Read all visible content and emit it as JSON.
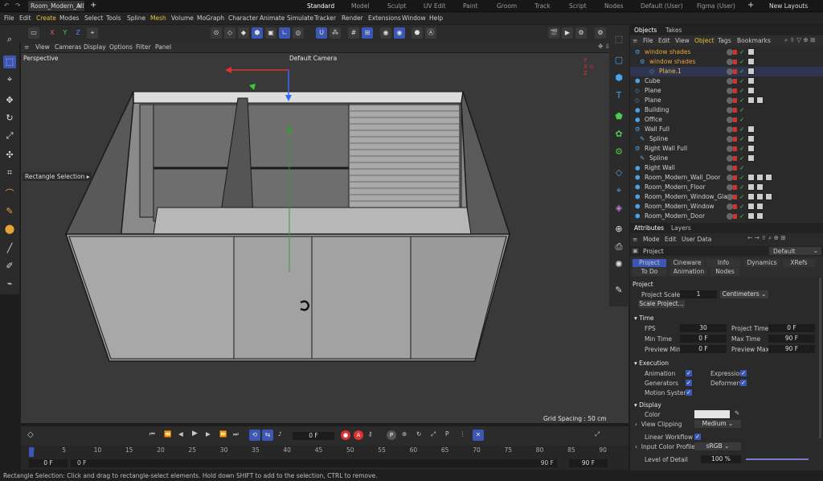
{
  "tabs": {
    "doc_title": "Room_Modern_All...",
    "layouts": [
      "Standard",
      "Model",
      "Sculpt",
      "UV Edit",
      "Paint",
      "Groom",
      "Track",
      "Script",
      "Nodes",
      "Default (User)",
      "Figma (User)"
    ],
    "new_layouts": "New Layouts"
  },
  "menu": [
    "File",
    "Edit",
    "Create",
    "Modes",
    "Select",
    "Tools",
    "Spline",
    "Mesh",
    "Volume",
    "MoGraph",
    "Character",
    "Animate",
    "Simulate",
    "Tracker",
    "Render",
    "Extensions",
    "Window",
    "Help"
  ],
  "axes_buttons": [
    "X",
    "Y",
    "Z"
  ],
  "viewport": {
    "menu": [
      "View",
      "Cameras",
      "Display",
      "Options",
      "Filter",
      "Panel"
    ],
    "label": "Perspective",
    "camera": "Default Camera",
    "tooltip": "Rectangle Selection",
    "grid_spacing": "Grid Spacing : 50 cm"
  },
  "objects": {
    "tabs": [
      "Objects",
      "Takes"
    ],
    "menu": [
      "File",
      "Edit",
      "View",
      "Object",
      "Tags",
      "Bookmarks"
    ],
    "rows": [
      {
        "name": "window shades",
        "color": "#e8a437"
      },
      {
        "name": "window shades",
        "color": "#e8a437"
      },
      {
        "name": "Plane.1",
        "color": "#e8c237"
      },
      {
        "name": "Cube",
        "color": "#d0d0d0"
      },
      {
        "name": "Plane",
        "color": "#d0d0d0"
      },
      {
        "name": "Plane",
        "color": "#d0d0d0"
      },
      {
        "name": "Building",
        "color": "#d0d0d0"
      },
      {
        "name": "Office",
        "color": "#d0d0d0"
      },
      {
        "name": "Wall Full",
        "color": "#d0d0d0"
      },
      {
        "name": "Spline",
        "color": "#d0d0d0"
      },
      {
        "name": "Right Wall Full",
        "color": "#d0d0d0"
      },
      {
        "name": "Spline",
        "color": "#d0d0d0"
      },
      {
        "name": "Right Wall",
        "color": "#d0d0d0"
      },
      {
        "name": "Room_Modern_Wall_Door",
        "color": "#d0d0d0"
      },
      {
        "name": "Room_Modern_Floor",
        "color": "#d0d0d0"
      },
      {
        "name": "Room_Modern_Window_Glass",
        "color": "#d0d0d0"
      },
      {
        "name": "Room_Modern_Window",
        "color": "#d0d0d0"
      },
      {
        "name": "Room_Modern_Door",
        "color": "#d0d0d0"
      }
    ]
  },
  "attributes": {
    "tabs": [
      "Attributes",
      "Layers"
    ],
    "menu": [
      "Mode",
      "Edit",
      "User Data"
    ],
    "object": "Project",
    "preset": "Default",
    "subtabs_row1": [
      "Project",
      "Cineware",
      "Info",
      "Dynamics",
      "XRefs"
    ],
    "subtabs_row2": [
      "To Do",
      "Animation",
      "Nodes"
    ],
    "section": "Project",
    "project_scale_label": "Project Scale",
    "project_scale": "1",
    "units": "Centimeters",
    "scale_button": "Scale Project...",
    "time_header": "Time",
    "fps_label": "FPS",
    "fps": "30",
    "project_time_label": "Project Time",
    "project_time": "0 F",
    "min_time_label": "Min Time",
    "min_time": "0 F",
    "max_time_label": "Max Time",
    "max_time": "90 F",
    "preview_min_label": "Preview Min",
    "preview_min": "0 F",
    "preview_max_label": "Preview Max",
    "preview_max": "90 F",
    "execution_header": "Execution",
    "animation_label": "Animation",
    "expression_label": "Expression",
    "generators_label": "Generators",
    "deformers_label": "Deformers",
    "motion_label": "Motion System",
    "display_header": "Display",
    "color_label": "Color",
    "clipping_label": "View Clipping",
    "clipping": "Medium",
    "linear_label": "Linear Workflow",
    "input_profile_label": "Input Color Profile",
    "input_profile": "sRGB",
    "lod_label": "Level of Detail",
    "lod": "100 %"
  },
  "timeline": {
    "current_frame": "0 F",
    "ticks": [
      "0",
      "5",
      "10",
      "15",
      "20",
      "25",
      "30",
      "35",
      "40",
      "45",
      "50",
      "55",
      "60",
      "65",
      "70",
      "75",
      "80",
      "85",
      "90"
    ],
    "start": "0 F",
    "start2": "0 F",
    "end": "90 F",
    "end2": "90 F"
  },
  "status": "Rectangle Selection: Click and drag to rectangle-select elements. Hold down SHIFT to add to the selection, CTRL to remove."
}
